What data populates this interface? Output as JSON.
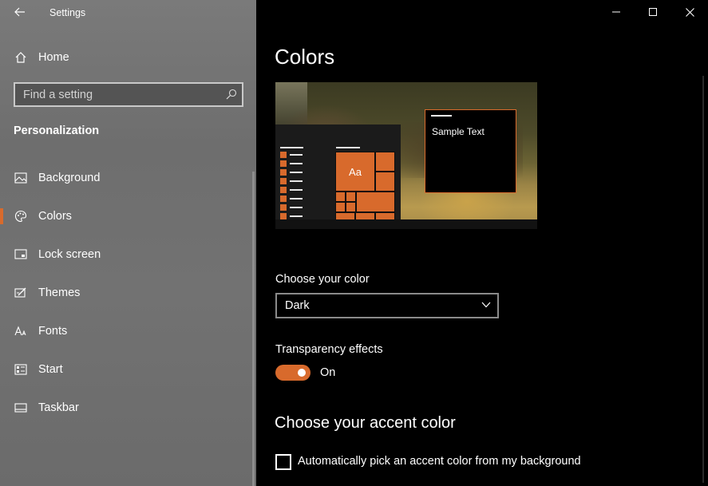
{
  "window": {
    "title": "Settings",
    "controls": [
      "minimize",
      "maximize",
      "close"
    ]
  },
  "sidebar": {
    "home_label": "Home",
    "search_placeholder": "Find a setting",
    "section_title": "Personalization",
    "items": [
      {
        "label": "Background",
        "icon": "picture-icon",
        "active": false
      },
      {
        "label": "Colors",
        "icon": "palette-icon",
        "active": true
      },
      {
        "label": "Lock screen",
        "icon": "lock-screen-icon",
        "active": false
      },
      {
        "label": "Themes",
        "icon": "themes-icon",
        "active": false
      },
      {
        "label": "Fonts",
        "icon": "fonts-icon",
        "active": false
      },
      {
        "label": "Start",
        "icon": "start-icon",
        "active": false
      },
      {
        "label": "Taskbar",
        "icon": "taskbar-icon",
        "active": false
      }
    ]
  },
  "main": {
    "title": "Colors",
    "preview": {
      "tile_text": "Aa",
      "sample_text": "Sample Text"
    },
    "choose_color": {
      "label": "Choose your color",
      "selected": "Dark"
    },
    "transparency": {
      "label": "Transparency effects",
      "state_text": "On",
      "enabled": true
    },
    "accent": {
      "title": "Choose your accent color",
      "auto_pick_label": "Automatically pick an accent color from my background",
      "auto_pick_checked": false
    }
  },
  "colors": {
    "accent": "#d86a2c",
    "sidebar_bg": "#727272",
    "main_bg": "#000000"
  }
}
